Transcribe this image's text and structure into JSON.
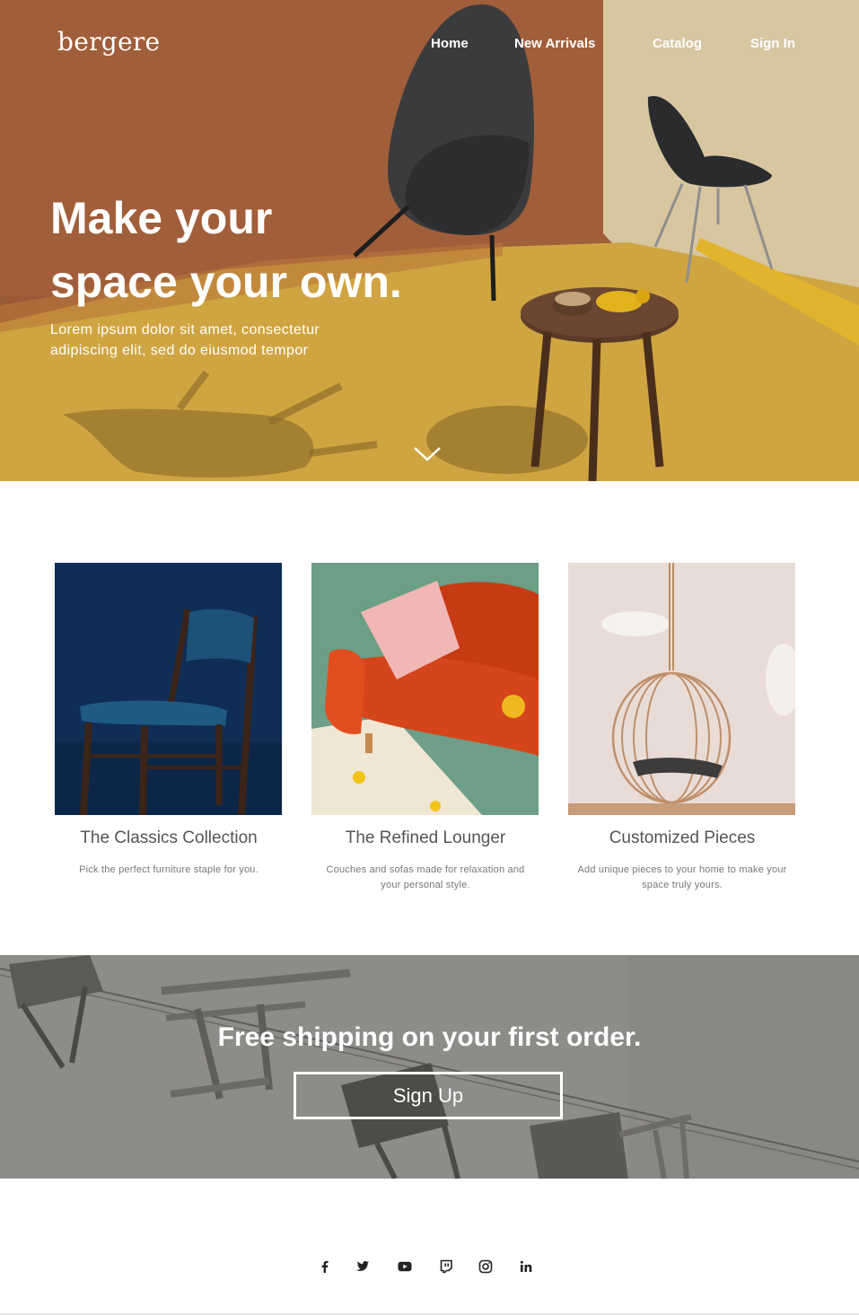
{
  "brand": {
    "logo": "bergere"
  },
  "nav": {
    "items": [
      {
        "label": "Home"
      },
      {
        "label": "New Arrivals"
      },
      {
        "label": "Catalog"
      },
      {
        "label": "Sign In"
      }
    ]
  },
  "hero": {
    "title_line1": "Make your",
    "title_line2": "space your own.",
    "subtitle": "Lorem ipsum dolor sit amet, consectetur adipiscing elit, sed do eiusmod tempor",
    "scroll_icon": "chevron-down-icon"
  },
  "cards": [
    {
      "title": "The Classics Collection",
      "description": "Pick the perfect furniture staple for you."
    },
    {
      "title": "The Refined Lounger",
      "description": "Couches and sofas made for relaxation and your personal style."
    },
    {
      "title": "Customized Pieces",
      "description": "Add unique pieces to your home to make your space truly yours."
    }
  ],
  "promo": {
    "title": "Free shipping on your first order.",
    "button_label": "Sign Up"
  },
  "footer": {
    "social": [
      "facebook-icon",
      "twitter-icon",
      "youtube-icon",
      "twitch-icon",
      "instagram-icon",
      "linkedin-icon"
    ]
  },
  "colors": {
    "hero_wall": "#9a5a38",
    "hero_floor": "#cfa541",
    "hero_side_wall": "#d7c6a0",
    "card1_bg": "#0f2d55",
    "card2_bg": "#6d9e86",
    "sofa": "#d4451b",
    "card3_bg": "#e9dcd6",
    "promo_bg": "#8e8c89",
    "text_white": "#ffffff"
  }
}
